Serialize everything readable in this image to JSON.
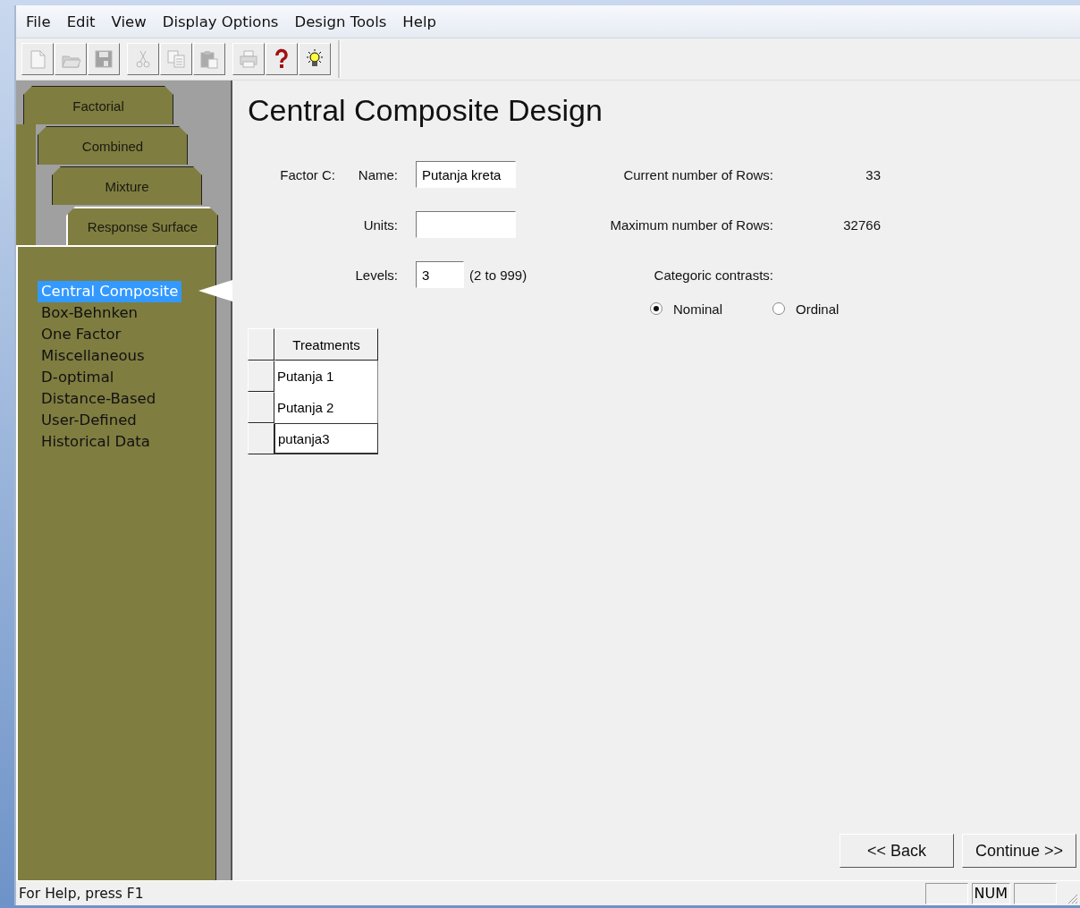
{
  "menu": [
    "File",
    "Edit",
    "View",
    "Display Options",
    "Design Tools",
    "Help"
  ],
  "toolbar": [
    [
      {
        "disabled": true
      },
      {
        "disabled": true
      },
      {
        "disabled": true
      }
    ],
    [
      {
        "disabled": true
      },
      {
        "disabled": true
      },
      {
        "disabled": true
      }
    ],
    [
      {
        "disabled": true
      },
      {
        "disabled": false
      },
      {
        "disabled": false
      }
    ]
  ],
  "design_tabs": [
    {
      "label": "Factorial",
      "selected": false
    },
    {
      "label": "Combined",
      "selected": false
    },
    {
      "label": "Mixture",
      "selected": false
    },
    {
      "label": "Response Surface",
      "selected": true
    }
  ],
  "design_types": [
    {
      "label": "Central Composite",
      "selected": true
    },
    {
      "label": "Box-Behnken",
      "selected": false
    },
    {
      "label": "One Factor",
      "selected": false
    },
    {
      "label": "Miscellaneous",
      "selected": false
    },
    {
      "label": "D-optimal",
      "selected": false
    },
    {
      "label": "Distance-Based",
      "selected": false
    },
    {
      "label": "User-Defined",
      "selected": false
    },
    {
      "label": "Historical Data",
      "selected": false
    }
  ],
  "title": "Central Composite Design",
  "factor": {
    "label": "Factor C:",
    "name": {
      "label": "Name:",
      "value": "Putanja kreta"
    },
    "units": {
      "label": "Units:"
    },
    "levels": {
      "label": "Levels:",
      "value": "3",
      "range": "(2 to 999)"
    }
  },
  "info": [
    {
      "label": "Current number of Rows:",
      "value": "33"
    },
    {
      "label": "Maximum number of Rows:",
      "value": "32766"
    }
  ],
  "contrasts": {
    "label": "Categoric contrasts:",
    "options": [
      {
        "label": "Nominal",
        "selected": true
      },
      {
        "label": "Ordinal",
        "selected": false
      }
    ]
  },
  "treatments": {
    "header": "Treatments",
    "rows": [
      {
        "value": "Putanja 1",
        "editing": false
      },
      {
        "value": "Putanja 2",
        "editing": false
      },
      {
        "value": "putanja3",
        "editing": true
      }
    ]
  },
  "buttons": [
    "<< Back",
    "Continue >>"
  ],
  "status_bar": {
    "text": "For Help, press F1",
    "indicators": [
      "NUM"
    ]
  }
}
